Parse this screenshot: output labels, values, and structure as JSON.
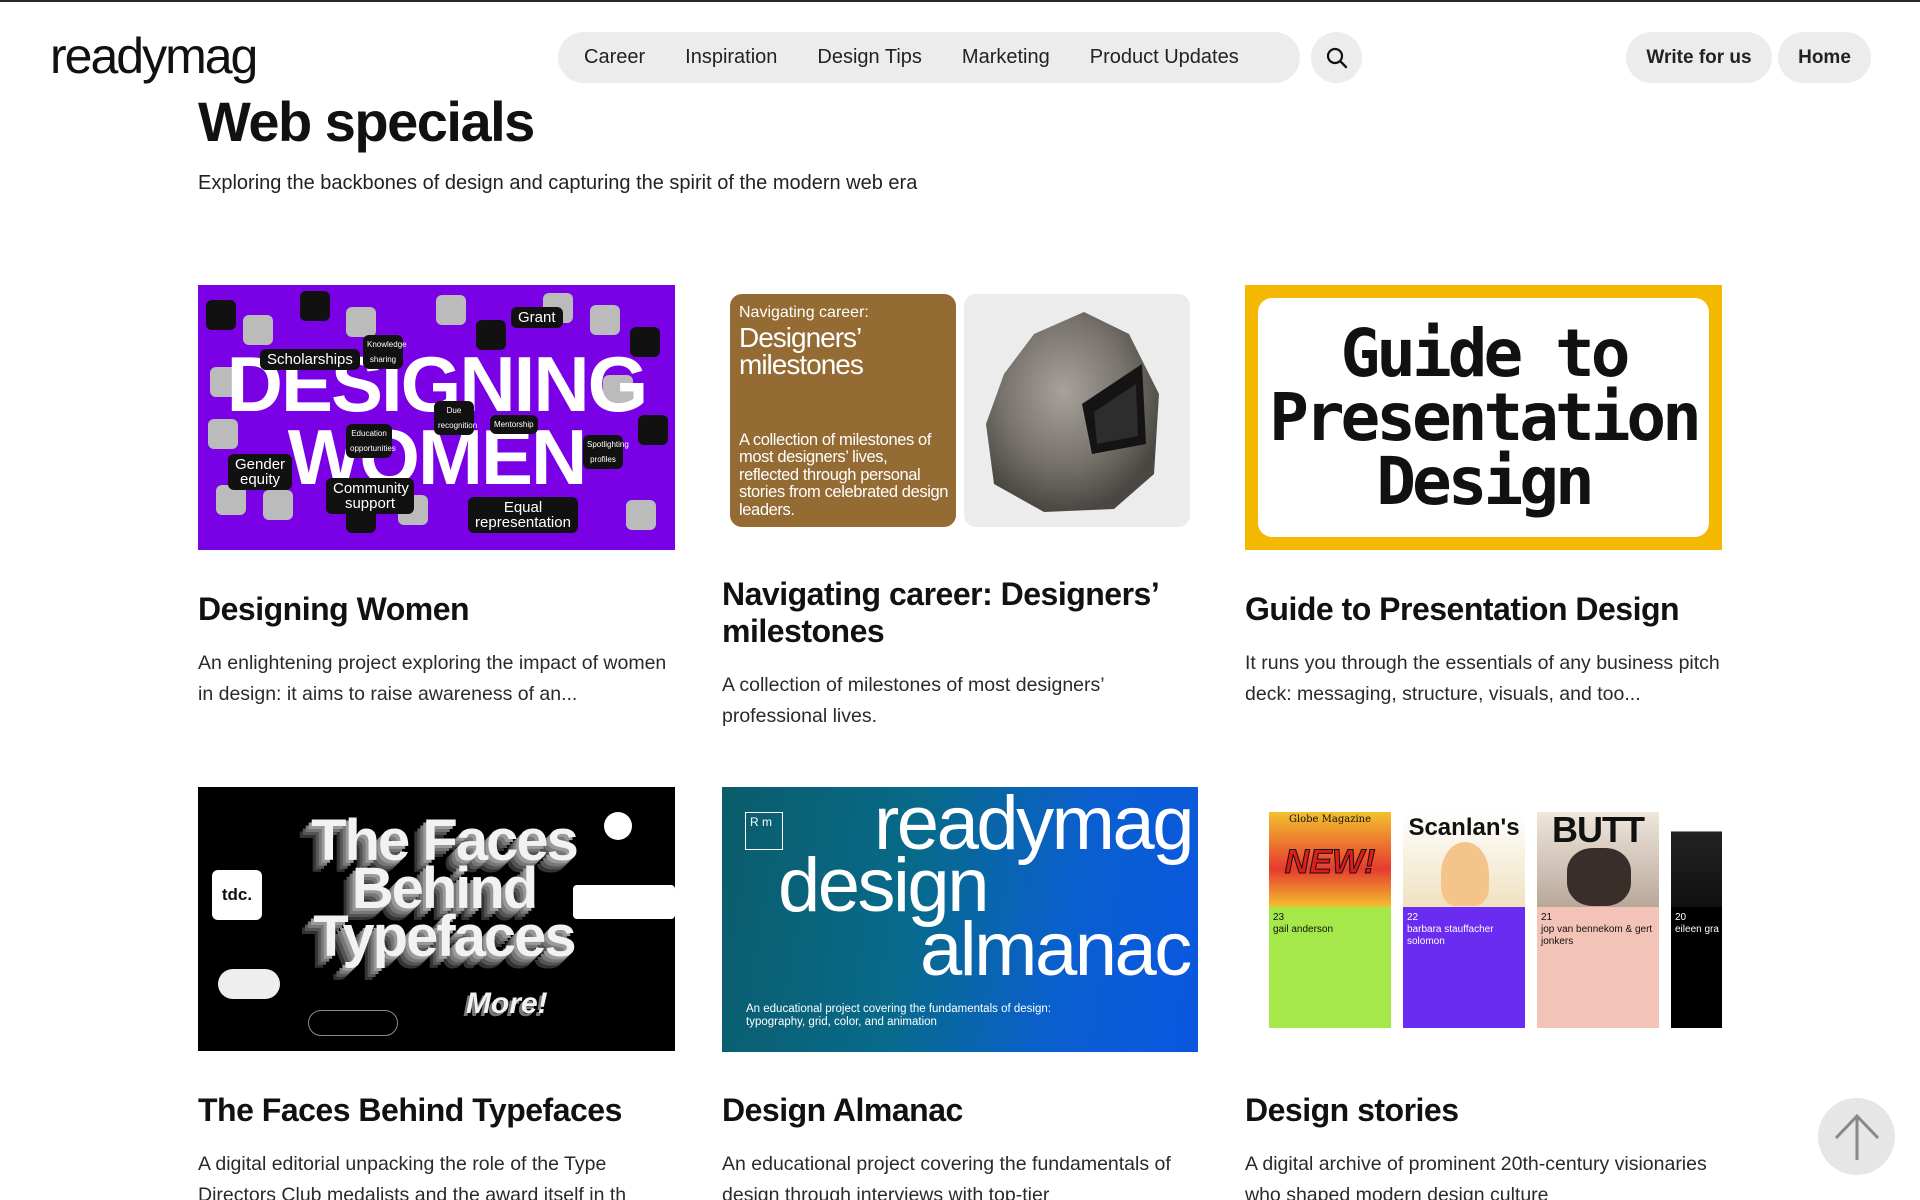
{
  "header": {
    "logo": "readymag",
    "nav": [
      "Career",
      "Inspiration",
      "Design Tips",
      "Marketing",
      "Product Updates"
    ],
    "write_label": "Write for us",
    "home_label": "Home"
  },
  "section": {
    "title": "Web specials",
    "subtitle": "Exploring the backbones of design and capturing the spirit of the modern web era"
  },
  "cards": [
    {
      "title": "Designing Women",
      "desc": "An enlightening project exploring the impact of women in design: it aims to raise awareness of an...",
      "thumb": {
        "word1": "DESIGNING",
        "word2": "WOMEN",
        "tags": [
          "Scholarships",
          "Grant",
          "Gender equity",
          "Community support",
          "Equal representation"
        ],
        "small_tags": [
          "Knowledge sharing",
          "Education opportunities",
          "Mentorship",
          "Spotlighting profiles",
          "Due recognition"
        ]
      }
    },
    {
      "title": "Navigating career: Designers’ milestones",
      "desc": "A collection of milestones of most designers’ professional lives.",
      "thumb": {
        "kicker": "Navigating career:",
        "heading": "Designers’ milestones",
        "text": "A collection of milestones of most designers’ lives, reflected through personal stories from celebrated design leaders."
      }
    },
    {
      "title": "Guide to Presentation Design",
      "desc": "It runs you through the essentials of any business pitch deck: messaging, structure, visuals, and too...",
      "thumb": {
        "text_lines": [
          "Guide to",
          "Presentation",
          "Design"
        ]
      }
    },
    {
      "title": "The Faces Behind Typefaces",
      "desc": "A digital editorial unpacking the role of the Type Directors Club medalists and the award itself in th",
      "thumb": {
        "lines": [
          "The Faces",
          "Behind",
          "Typefaces"
        ],
        "more": "More!",
        "tdc": "tdc."
      }
    },
    {
      "title": "Design Almanac",
      "desc": "An educational project covering the fundamentals of design through interviews with top-tier",
      "thumb": {
        "rm": "R m",
        "word1": "readymag",
        "word2": "design",
        "word3": "almanac",
        "small": "An educational project covering the fundamentals of design: typography, grid, color, and animation"
      }
    },
    {
      "title": "Design stories",
      "desc": "A digital archive of prominent 20th-century visionaries who shaped modern design culture",
      "thumb": {
        "covers": [
          {
            "magazine": "Globe Magazine",
            "headline": "NEW!",
            "number": "23",
            "name": "gail anderson",
            "color": "#a6e84a"
          },
          {
            "magazine": "Scanlan's",
            "headline": "",
            "number": "22",
            "name": "barbara stauffacher solomon",
            "color": "#6a2cf0"
          },
          {
            "magazine": "BUTT",
            "headline": "",
            "number": "21",
            "name": "jop van bennekom & gert jonkers",
            "color": "#f3c3b8"
          },
          {
            "magazine": "",
            "headline": "",
            "number": "20",
            "name": "eileen gra",
            "color": "#000000"
          }
        ]
      }
    }
  ],
  "colors": {
    "pill_bg": "#ececec",
    "purple": "#7a00e6",
    "gold_frame": "#f5b800",
    "brown_box": "#946b33"
  },
  "icons": {
    "search": "search-icon",
    "scroll_top": "arrow-up-icon"
  }
}
